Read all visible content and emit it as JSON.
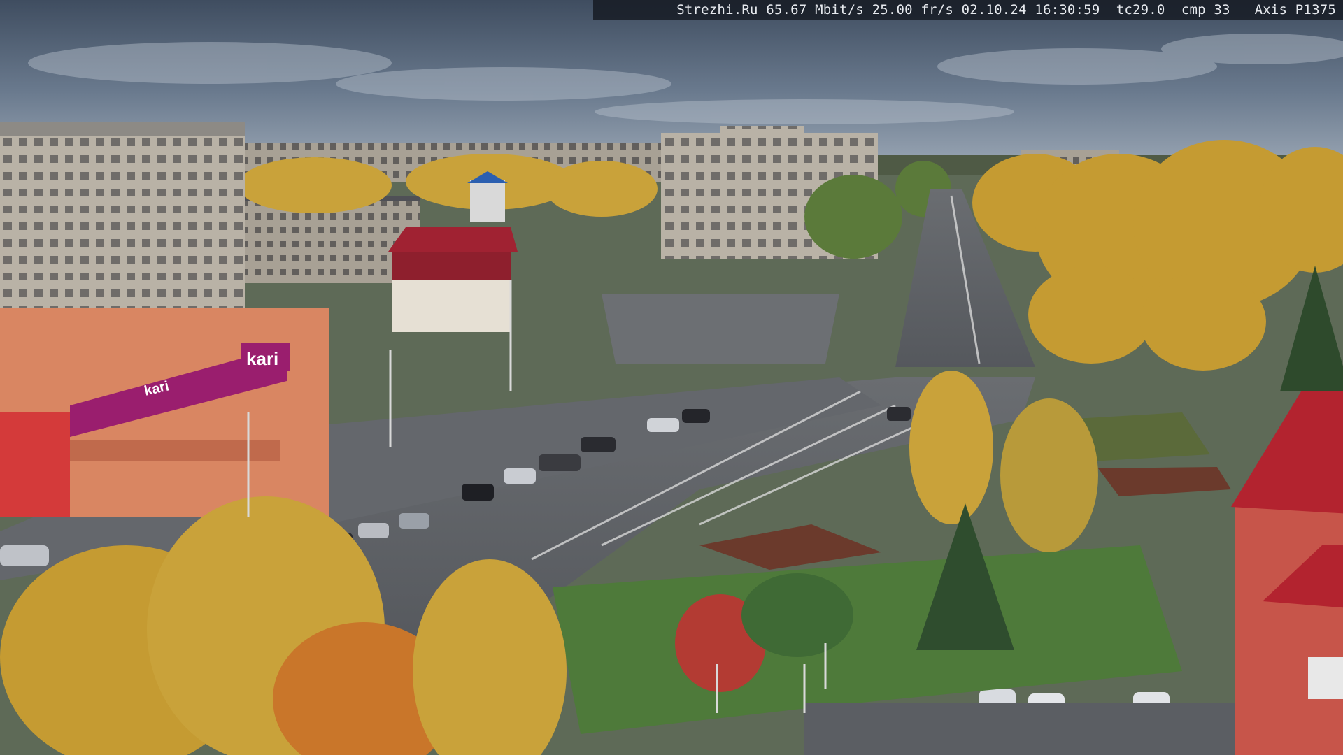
{
  "overlay": {
    "text": "Strezhi.Ru 65.67 Mbit/s 25.00 fr/s 02.10.24 16:30:59  tc29.0  cmp 33   Axis P1375"
  },
  "storefront": {
    "sign_logo": "kari",
    "sign_banner": "kari"
  },
  "colors": {
    "sky": "#4a5a6d",
    "sky_light": "#8393a6",
    "foliage_yellow": "#c9a23a",
    "foliage_orange": "#c9762a",
    "grass": "#4e7a3a",
    "asphalt": "#5a5d62",
    "brand_magenta": "#9a1e6e",
    "roof_red": "#b3232f"
  }
}
